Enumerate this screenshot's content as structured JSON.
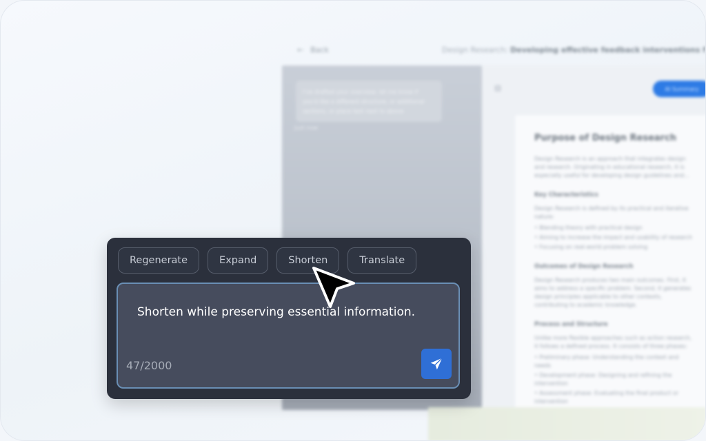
{
  "background": {
    "back_label": "Back",
    "doc_title_prefix": "Design Research:",
    "doc_title_main": "Developing effective feedback interventions f",
    "left_card_text": "I’ve drafted your overview; let me know if you'd like a different structure, or additional sections, or place text next to above",
    "left_card_meta": "Just now",
    "summary_button": "AI Summary",
    "doc": {
      "heading": "Purpose of Design Research",
      "intro": "Design Research is an approach that integrates design and research. Originating in educational research, it is especially useful for developing design guidelines and...",
      "sections": [
        {
          "title": "Key Characteristics",
          "text": "Design Research is defined by its practical and iterative nature:",
          "bullets": [
            "Blending theory with practical design",
            "Aiming to increase the impact and usability of research",
            "Focusing on real-world problem solving"
          ]
        },
        {
          "title": "Outcomes of Design Research",
          "text": "Design Research produces two main outcomes. First, it aims to address a specific problem. Second, it generates design principles applicable to other contexts, contributing to academic knowledge.",
          "bullets": []
        },
        {
          "title": "Process and Structure",
          "text": "Unlike more flexible approaches such as action research, it follows a defined process. It consists of three phases:",
          "bullets": [
            "Preliminary phase: Understanding the context and needs",
            "Development phase: Designing and refining the intervention",
            "Assessment phase: Evaluating the final product or intervention"
          ]
        }
      ]
    }
  },
  "popup": {
    "chips": [
      "Regenerate",
      "Expand",
      "Shorten",
      "Translate"
    ],
    "input_value": "Shorten while preserving essential information.",
    "counter": "47/2000",
    "send_icon": "paper-plane-icon"
  },
  "colors": {
    "popup_bg": "#2b303c",
    "input_bg": "#464c5d",
    "input_border": "#6a8fb5",
    "send_bg": "#2f6fd6",
    "summary_bg": "#2d7be5"
  }
}
